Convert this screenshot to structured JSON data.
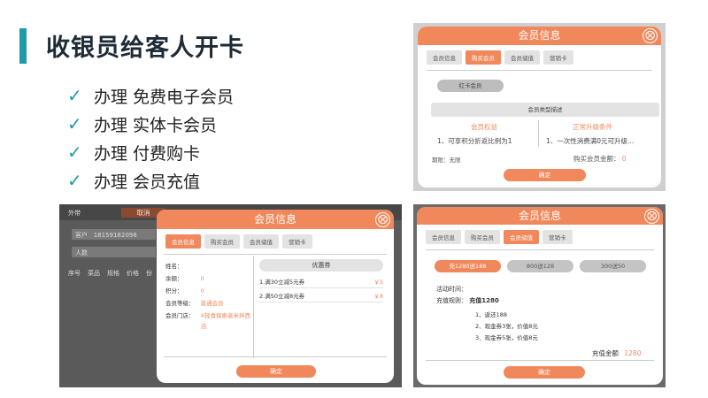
{
  "slide": {
    "title": "收银员给客人开卡",
    "bullets": [
      {
        "check": "✓",
        "text": "办理 免费电子会员"
      },
      {
        "check": "✓",
        "text": "办理 实体卡会员"
      },
      {
        "check": "✓",
        "text": "办理 付费购卡"
      },
      {
        "check": "✓",
        "text": "办理 会员充值"
      }
    ]
  },
  "colors": {
    "accent_teal": "#1e9aa8",
    "dialog_orange": "#f0885c",
    "title": "#1d2b36"
  },
  "panel_buy_card": {
    "title": "会员信息",
    "close": "⨂",
    "tabs": [
      "会员信息",
      "购买会员",
      "会员储值",
      "营销卡"
    ],
    "active_tab": 1,
    "card_button": "红卡会员",
    "type_desc_title": "会员类型描述",
    "col_left_title": "会员权益",
    "col_right_title": "正常升级条件",
    "col_left_text": "1、可享积分折返比例为1",
    "col_right_text": "1、一次性消费满0元可升级...",
    "period": "期限：无限",
    "amount_label": "购买会员金额：",
    "amount_value": "0",
    "confirm": "确定"
  },
  "panel_member_info": {
    "bg": {
      "label_outside": "外带",
      "cancel": "取消",
      "customer_label": "客户",
      "customer_phone": "18159182098",
      "people_label": "人数",
      "table_headers": [
        "序号",
        "菜品",
        "规格",
        "价格",
        "份"
      ]
    },
    "title": "会员信息",
    "close": "⨂",
    "tabs": [
      "会员信息",
      "购买会员",
      "会员储值",
      "营销卡"
    ],
    "active_tab": 0,
    "info": {
      "name_label": "姓名：",
      "balance_label": "余额：",
      "balance_value": "0",
      "points_label": "积分：",
      "points_value": "0",
      "level_label": "会员等级：",
      "level_value": "普通会员",
      "store_label": "会员门店：",
      "store_value": "X轻食探索者米拌西",
      "store_value_2": "店"
    },
    "coupon_title": "优惠券",
    "coupons": [
      {
        "name": "1.满30立减5元券",
        "amount": "￥5"
      },
      {
        "name": "2.满50立减8元券",
        "amount": "￥8"
      }
    ],
    "confirm": "确定"
  },
  "panel_recharge": {
    "title": "会员信息",
    "close": "⨂",
    "tabs": [
      "会员信息",
      "购买会员",
      "会员储值",
      "营销卡"
    ],
    "active_tab": 2,
    "options": [
      "充1280送188",
      "800送128",
      "300送50"
    ],
    "selected_option": 0,
    "activity_time": "活动时间：",
    "rule_label": "充值规则：",
    "rule_value": "充值1280",
    "rule_items": [
      "1、返还188",
      "2、现金券3张，价值8元",
      "3、现金券5张，价值8元"
    ],
    "amount_label": "充值金额",
    "amount_value": "1280",
    "confirm": "确定"
  }
}
